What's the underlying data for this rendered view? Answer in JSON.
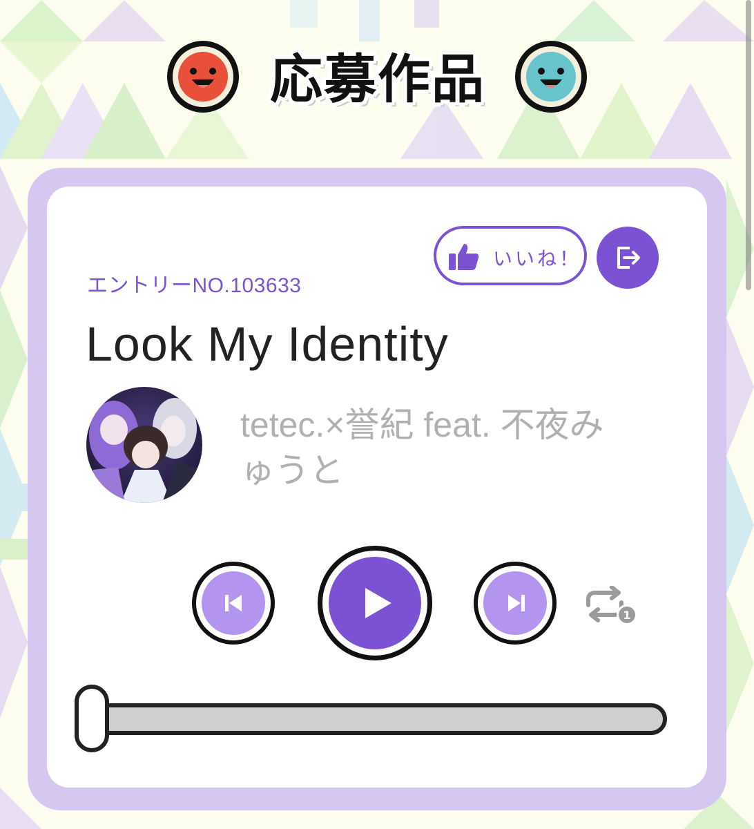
{
  "header": {
    "title": "応募作品",
    "left_mascot_icon": "red-drum-face-icon",
    "right_mascot_icon": "blue-drum-face-icon"
  },
  "entry": {
    "entry_label": "エントリーNO.103633",
    "title": "Look My Identity",
    "artist": "tetec.×誉紀 feat. 不夜みゅうと",
    "avatar_icon": "artist-avatar"
  },
  "actions": {
    "like_label": "いいね！",
    "like_icon": "thumbs-up-icon",
    "share_icon": "share-exit-icon"
  },
  "player": {
    "prev_icon": "skip-previous-icon",
    "play_icon": "play-icon",
    "next_icon": "skip-next-icon",
    "repeat_icon": "repeat-one-icon",
    "repeat_badge": "1",
    "progress": 0
  },
  "colors": {
    "accent": "#7b52d4",
    "accent_light": "#b394ee",
    "frame": "#d6c7f0",
    "artist_text": "#b0b0b0"
  }
}
